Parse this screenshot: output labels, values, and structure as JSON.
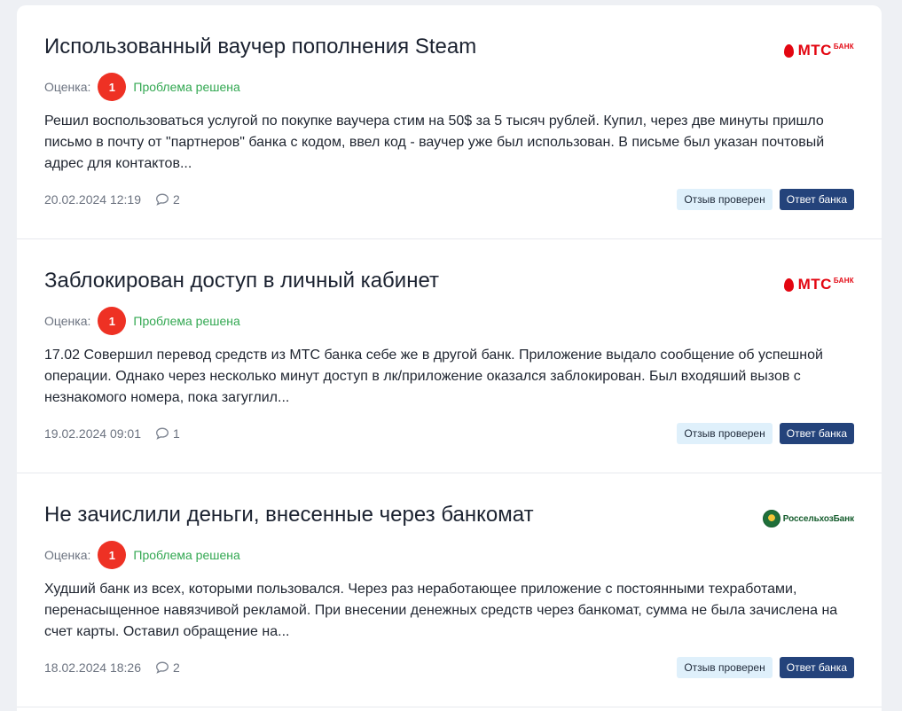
{
  "reviews": [
    {
      "title": "Использованный ваучер пополнения Steam",
      "bank_logo": {
        "word": "МТС",
        "sub": "БАНК"
      },
      "rating_label": "Оценка:",
      "rating_value": "1",
      "status": "Проблема решена",
      "body": "Решил воспользоваться услугой по покупке ваучера стим на 50$ за 5 тысяч рублей. Купил, через две минуты пришло письмо в почту от \"партнеров\" банка с кодом, ввел код - ваучер уже был использован.  В письме был указан почтовый адрес для контактов...",
      "date": "20.02.2024 12:19",
      "comments": "2",
      "tag_verified": "Отзыв проверен",
      "tag_bank_answer": "Ответ банка"
    },
    {
      "title": "Заблокирован доступ в личный кабинет",
      "bank_logo": {
        "word": "МТС",
        "sub": "БАНК"
      },
      "rating_label": "Оценка:",
      "rating_value": "1",
      "status": "Проблема решена",
      "body": "17.02 Совершил перевод средств из МТС банка себе же в другой банк. Приложение выдало сообщение об успешной операции. Однако через несколько минут доступ в лк/приложение оказался заблокирован. Был входяший вызов с незнакомого номера, пока загуглил...",
      "date": "19.02.2024 09:01",
      "comments": "1",
      "tag_verified": "Отзыв проверен",
      "tag_bank_answer": "Ответ банка"
    },
    {
      "title": "Не зачислили деньги, внесенные через банкомат",
      "bank_logo": {
        "word": "РоссельхозБанк"
      },
      "rating_label": "Оценка:",
      "rating_value": "1",
      "status": "Проблема решена",
      "body": "Худший банк из всех, которыми пользовался. Через раз неработающее приложение с постоянными техработами, перенасыщенное навязчивой рекламой. При внесении денежных средств через банкомат, сумма не была зачислена на счет карты. Оставил обращение на...",
      "date": "18.02.2024 18:26",
      "comments": "2",
      "tag_verified": "Отзыв проверен",
      "tag_bank_answer": "Ответ банка"
    }
  ],
  "colors": {
    "rating_badge": "#ee3124",
    "status_resolved": "#33a852",
    "tag_verified_bg": "#dff0fb",
    "tag_bank_answer_bg": "#24437b",
    "mts_brand": "#e30611",
    "rshb_brand": "#155c2d"
  },
  "icons": {
    "comment": "comment-bubble-icon",
    "mts_logo": "mts-bank-logo",
    "rshb_logo": "rosselkhozbank-logo"
  }
}
